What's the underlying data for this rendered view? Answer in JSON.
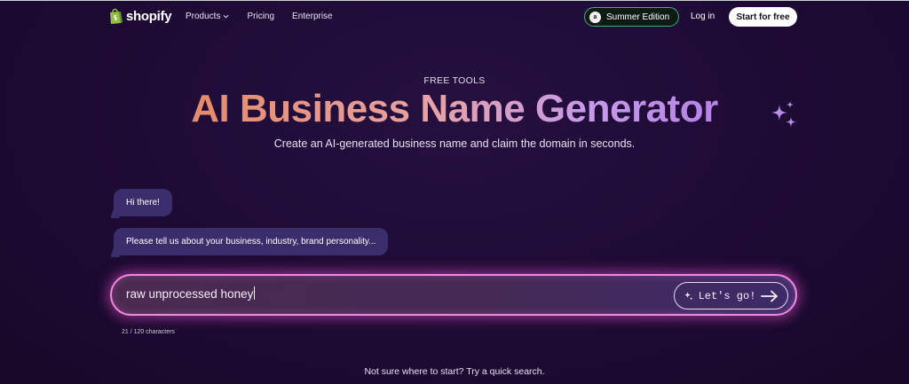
{
  "nav": {
    "brand": "shopify",
    "links": [
      "Products",
      "Pricing",
      "Enterprise"
    ],
    "edition": "Summer Edition",
    "edition_badge": "a",
    "login": "Log in",
    "start": "Start for free"
  },
  "hero": {
    "eyebrow": "FREE TOOLS",
    "title": "AI Business Name Generator",
    "subtitle": "Create an AI-generated business name and claim the domain in seconds."
  },
  "chat": {
    "messages": [
      "Hi there!",
      "Please tell us about your business, industry, brand personality..."
    ]
  },
  "input": {
    "value": "raw unprocessed honey",
    "button": "Let's go!",
    "counter": "21 / 120 characters"
  },
  "hint": "Not sure where to start? Try a quick search.",
  "colors": {
    "background": "#1d0a33",
    "bubble": "#3a2d6b",
    "input_glow": "#f08ae0",
    "edition_border": "#3fae7a",
    "logo_green": "#95bf47"
  }
}
